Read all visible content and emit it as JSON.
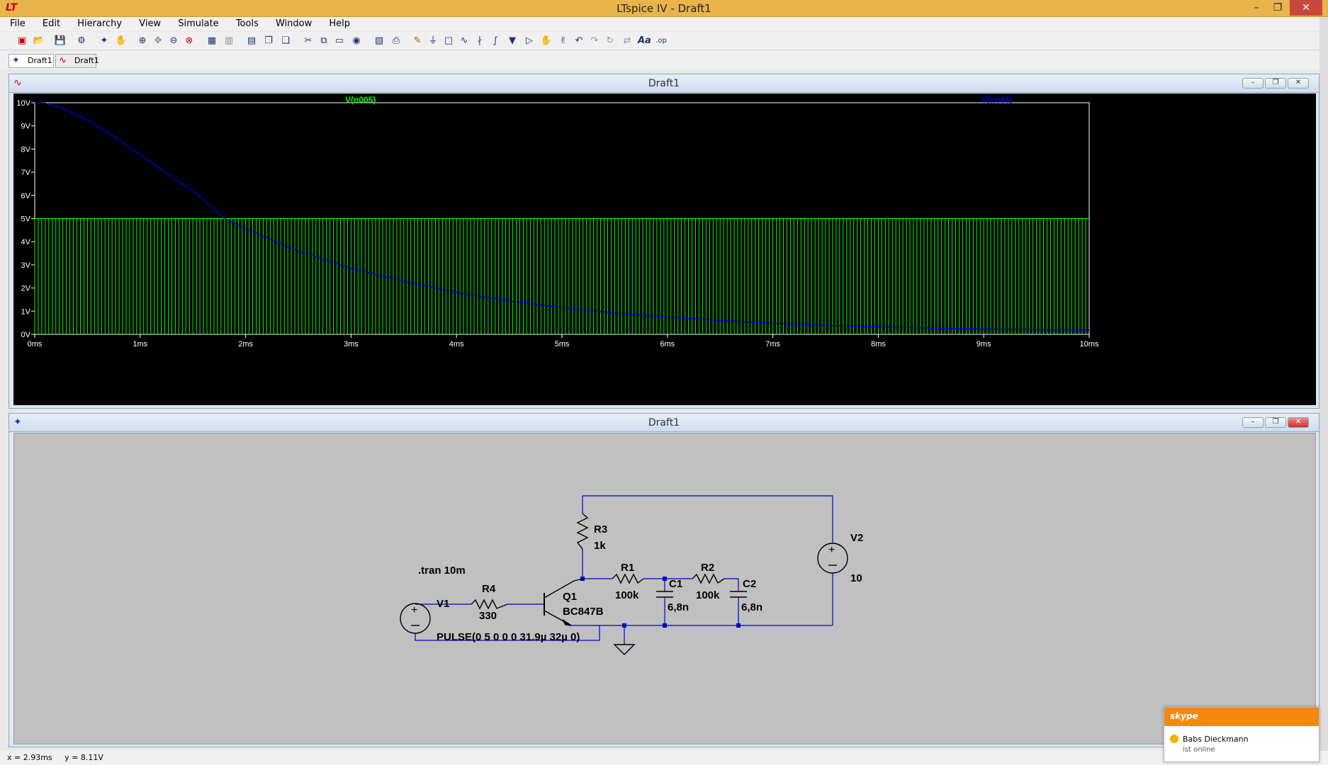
{
  "window": {
    "title": "LTspice IV - Draft1",
    "app_icon": "LT"
  },
  "menu": [
    "File",
    "Edit",
    "Hierarchy",
    "View",
    "Simulate",
    "Tools",
    "Window",
    "Help"
  ],
  "tabs": [
    {
      "label": "Draft1",
      "icon": "schematic-icon"
    },
    {
      "label": "Draft1",
      "icon": "waveform-icon"
    }
  ],
  "waveform_window": {
    "title": "Draft1"
  },
  "schematic_window": {
    "title": "Draft1"
  },
  "chart_data": {
    "type": "line",
    "title": "",
    "xlabel": "",
    "ylabel": "",
    "xlim": [
      0,
      10
    ],
    "ylim": [
      0,
      10
    ],
    "x_ticks": [
      "0ms",
      "1ms",
      "2ms",
      "3ms",
      "4ms",
      "5ms",
      "6ms",
      "7ms",
      "8ms",
      "9ms",
      "10ms"
    ],
    "y_ticks": [
      "0V",
      "1V",
      "2V",
      "3V",
      "4V",
      "5V",
      "6V",
      "7V",
      "8V",
      "9V",
      "10V"
    ],
    "grid": false,
    "series": [
      {
        "name": "V(n005)",
        "color": "#00ff00",
        "kind": "pulse",
        "low": 0,
        "high": 5,
        "period_ms": 0.032
      },
      {
        "name": "V(n004)",
        "color": "#0000cc",
        "x": [
          0,
          0.1,
          0.25,
          0.5,
          0.75,
          1,
          1.25,
          1.5,
          1.8,
          2,
          2.5,
          3,
          3.5,
          4,
          4.5,
          5,
          5.5,
          6,
          6.5,
          7,
          7.5,
          8,
          8.5,
          9,
          9.5,
          10
        ],
        "values": [
          10,
          9.98,
          9.8,
          9.25,
          8.55,
          7.75,
          6.95,
          6.2,
          5.0,
          4.55,
          3.6,
          2.85,
          2.3,
          1.8,
          1.45,
          1.15,
          0.92,
          0.74,
          0.6,
          0.48,
          0.39,
          0.32,
          0.27,
          0.23,
          0.2,
          0.18
        ]
      }
    ]
  },
  "schematic": {
    "directive": ".tran 10m",
    "components": {
      "v1": {
        "name": "V1",
        "value": "PULSE(0 5 0 0 0 31.9µ 32µ 0)"
      },
      "r4": {
        "name": "R4",
        "value": "330"
      },
      "q1": {
        "name": "Q1",
        "value": "BC847B"
      },
      "r3": {
        "name": "R3",
        "value": "1k"
      },
      "r1": {
        "name": "R1",
        "value": "100k"
      },
      "c1": {
        "name": "C1",
        "value": "6,8n"
      },
      "r2": {
        "name": "R2",
        "value": "100k"
      },
      "c2": {
        "name": "C2",
        "value": "6,8n"
      },
      "v2": {
        "name": "V2",
        "value": "10"
      }
    },
    "wire_color": "#0000c8",
    "component_color": "#000000"
  },
  "status": {
    "x": "x = 2.93ms",
    "y": "y = 8.11V"
  },
  "skype": {
    "brand": "skype",
    "contact": "Babs Dieckmann",
    "status": "ist online"
  }
}
